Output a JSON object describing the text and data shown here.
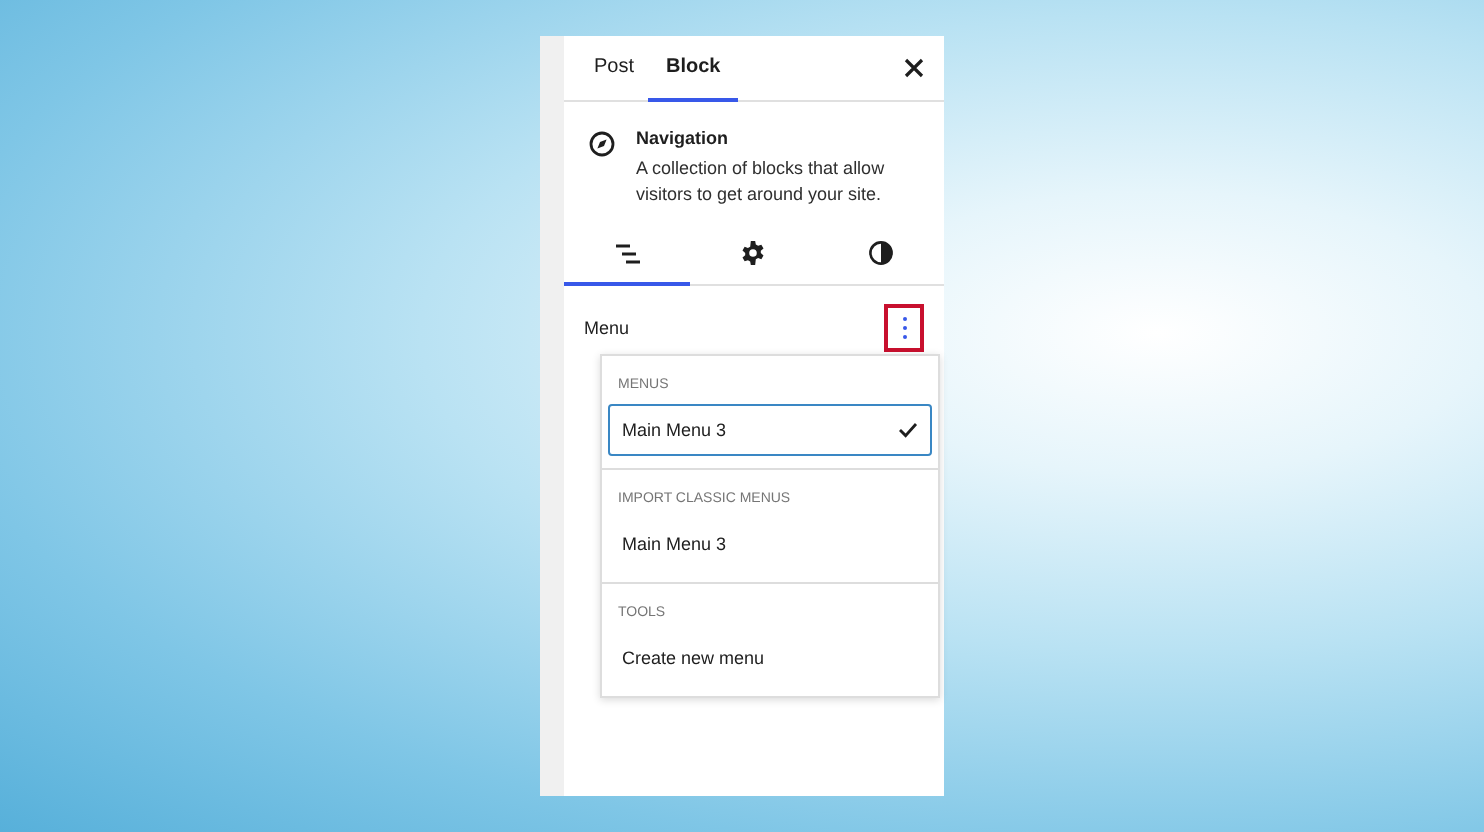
{
  "tabs": [
    {
      "label": "Post",
      "selected": false
    },
    {
      "label": "Block",
      "selected": true
    }
  ],
  "block": {
    "title": "Navigation",
    "description": "A collection of blocks that allow visitors to get around your site."
  },
  "inspector_tabs": [
    {
      "kind": "list",
      "selected": true
    },
    {
      "kind": "settings",
      "selected": false
    },
    {
      "kind": "styles",
      "selected": false
    }
  ],
  "menu": {
    "label": "Menu",
    "options_highlighted": true
  },
  "dropdown": [
    {
      "heading": "MENUS",
      "items": [
        {
          "label": "Main Menu 3",
          "selected": true
        }
      ]
    },
    {
      "heading": "IMPORT CLASSIC MENUS",
      "items": [
        {
          "label": "Main Menu 3",
          "selected": false
        }
      ]
    },
    {
      "heading": "TOOLS",
      "items": [
        {
          "label": "Create new menu",
          "selected": false
        }
      ]
    }
  ]
}
